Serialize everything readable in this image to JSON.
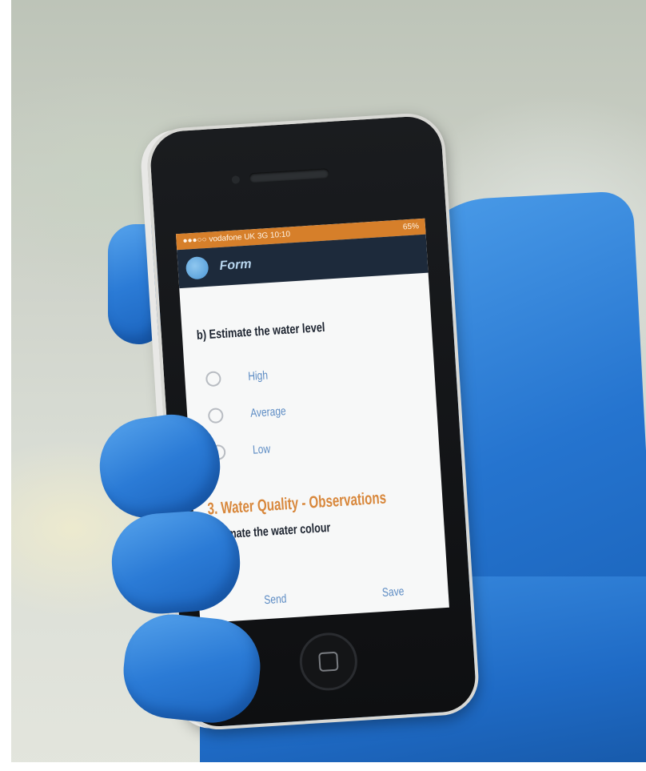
{
  "status_bar": {
    "carrier": "●●●○○ vodafone UK  3G  10:10",
    "battery": "65%"
  },
  "app_bar": {
    "title": "Form",
    "icon": "app-logo-icon"
  },
  "form": {
    "question": "b) Estimate the water level",
    "options": [
      {
        "label": "High",
        "selected": false
      },
      {
        "label": "Average",
        "selected": false
      },
      {
        "label": "Low",
        "selected": false
      }
    ],
    "section_heading": "3. Water Quality - Observations",
    "sub_question": "Estimate the water colour"
  },
  "bottom_bar": {
    "send_label": "Send",
    "save_label": "Save"
  },
  "colors": {
    "status_bar": "#d67f2a",
    "app_bar": "#1d2a3b",
    "accent_link": "#5d8cc4",
    "section_heading": "#d8873b",
    "glove": "#2574cf"
  }
}
